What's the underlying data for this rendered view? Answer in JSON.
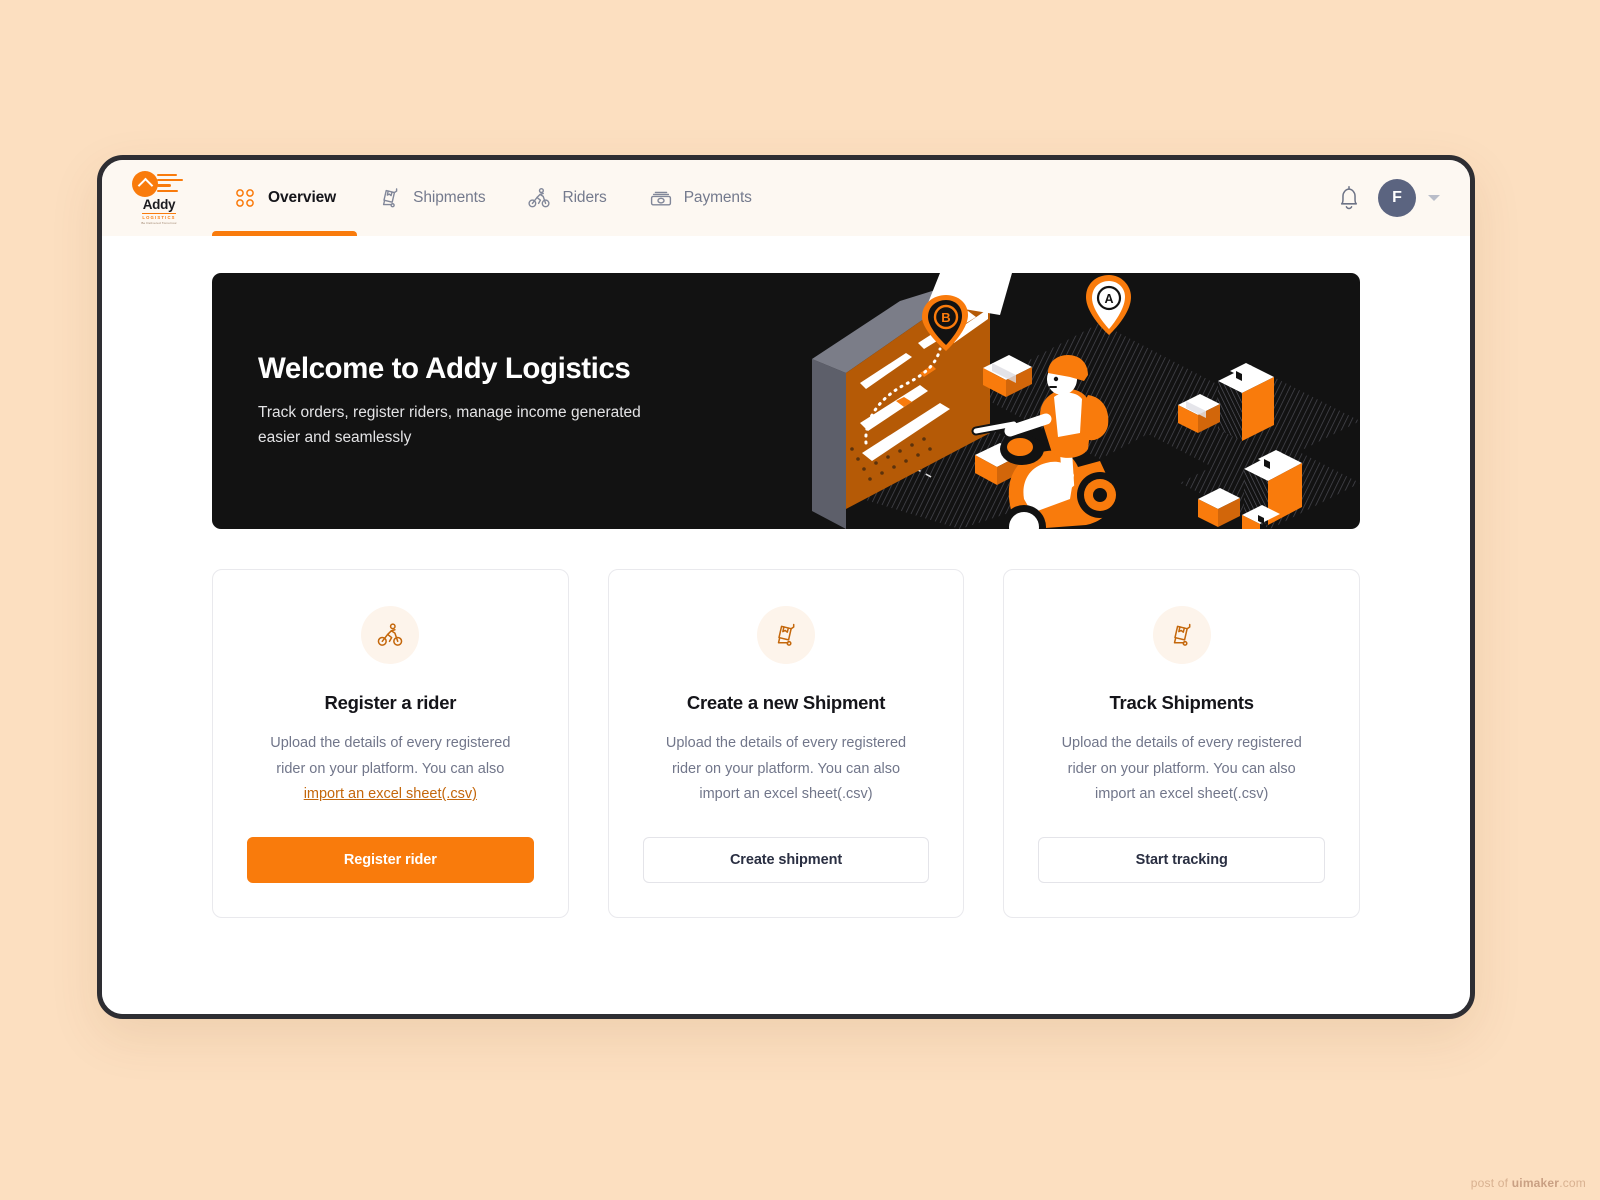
{
  "theme": {
    "page_background": "#FCDFC0",
    "accent": "#F97B0C",
    "hero_background": "#121212",
    "topbar_background": "#FDF8F2",
    "muted_text": "#71768a",
    "avatar_background": "#5B6480"
  },
  "brand": {
    "name": "Addy",
    "subtitle": "LOGISTICS",
    "tagline": "Be Delivered Tomorrow"
  },
  "nav": {
    "items": [
      {
        "label": "Overview",
        "icon": "grid-icon",
        "active": true
      },
      {
        "label": "Shipments",
        "icon": "dolly-icon",
        "active": false
      },
      {
        "label": "Riders",
        "icon": "cyclist-icon",
        "active": false
      },
      {
        "label": "Payments",
        "icon": "cash-icon",
        "active": false
      }
    ]
  },
  "topbar_right": {
    "notification_icon": "bell-icon",
    "avatar_initial": "F",
    "caret_icon": "chevron-down-icon"
  },
  "hero": {
    "title": "Welcome to Addy Logistics",
    "subtitle": "Track orders, register riders, manage income generated easier and seamlessly",
    "illustration": "isometric-delivery-rider-map-illustration",
    "map_pins": [
      "A",
      "B"
    ]
  },
  "cards": [
    {
      "icon": "cyclist-icon",
      "title": "Register a rider",
      "desc_before": "Upload the details of every registered rider on your platform. You can also ",
      "link": "import an excel sheet(.csv)",
      "desc_after": "",
      "button": "Register rider",
      "button_style": "primary"
    },
    {
      "icon": "dolly-icon",
      "title": "Create a new Shipment",
      "desc_before": "Upload the details of every registered rider on your platform. You can also import an excel sheet(.csv)",
      "link": "",
      "desc_after": "",
      "button": "Create shipment",
      "button_style": "secondary"
    },
    {
      "icon": "dolly-icon",
      "title": "Track Shipments",
      "desc_before": "Upload the details of every registered rider on your platform. You can also import an excel sheet(.csv)",
      "link": "",
      "desc_after": "",
      "button": "Start tracking",
      "button_style": "secondary"
    }
  ],
  "watermark": {
    "prefix": "post of ",
    "brand": "uimaker",
    "suffix": ".com"
  }
}
